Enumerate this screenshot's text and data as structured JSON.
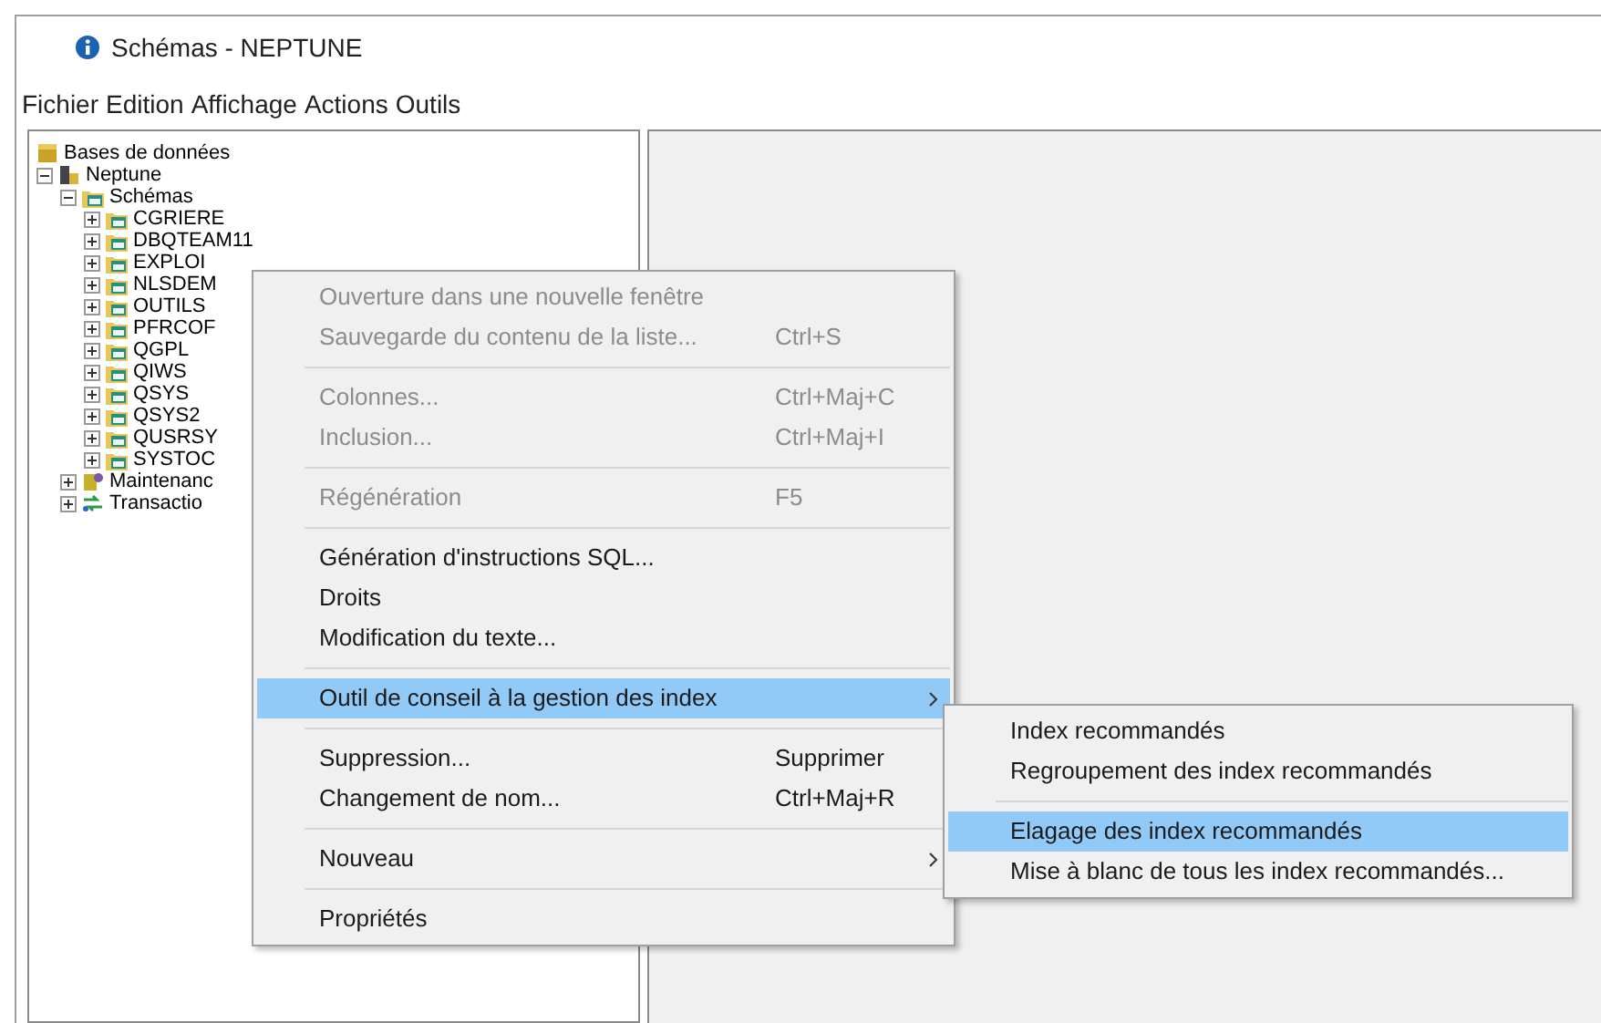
{
  "window": {
    "title": "Schémas - NEPTUNE"
  },
  "menubar": [
    "Fichier",
    "Edition",
    "Affichage",
    "Actions",
    "Outils"
  ],
  "tree": [
    {
      "label": "Bases de données",
      "kind": "databases",
      "children": [
        {
          "label": "Neptune",
          "kind": "system",
          "expanded": true,
          "children": [
            {
              "label": "Schémas",
              "kind": "schemas",
              "expanded": true,
              "children": [
                {
                  "label": "CGRIERE",
                  "kind": "schema",
                  "expanded": false
                },
                {
                  "label": "DBQTEAM11",
                  "kind": "schema",
                  "expanded": false
                },
                {
                  "label": "EXPLOI",
                  "kind": "schema",
                  "expanded": false
                },
                {
                  "label": "NLSDEM",
                  "kind": "schema",
                  "expanded": false
                },
                {
                  "label": "OUTILS",
                  "kind": "schema",
                  "expanded": false
                },
                {
                  "label": "PFRCOF",
                  "kind": "schema",
                  "expanded": false
                },
                {
                  "label": "QGPL",
                  "kind": "schema",
                  "expanded": false
                },
                {
                  "label": "QIWS",
                  "kind": "schema",
                  "expanded": false
                },
                {
                  "label": "QSYS",
                  "kind": "schema",
                  "expanded": false
                },
                {
                  "label": "QSYS2",
                  "kind": "schema",
                  "expanded": false
                },
                {
                  "label": "QUSRSY",
                  "kind": "schema",
                  "expanded": false
                },
                {
                  "label": "SYSTOC",
                  "kind": "schema",
                  "expanded": false
                }
              ]
            },
            {
              "label": "Maintenanc",
              "kind": "maintenance",
              "expanded": false
            },
            {
              "label": "Transactio",
              "kind": "transactions",
              "expanded": false
            }
          ]
        }
      ]
    }
  ],
  "context_menu": {
    "groups": [
      [
        {
          "label": "Ouverture dans une nouvelle fenêtre",
          "disabled": true,
          "selected": false,
          "submenu": false
        },
        {
          "label": "Sauvegarde du contenu de la liste...",
          "shortcut": "Ctrl+S",
          "disabled": true,
          "selected": false,
          "submenu": false
        }
      ],
      [
        {
          "label": "Colonnes...",
          "shortcut": "Ctrl+Maj+C",
          "disabled": true,
          "selected": false,
          "submenu": false
        },
        {
          "label": "Inclusion...",
          "shortcut": "Ctrl+Maj+I",
          "disabled": true,
          "selected": false,
          "submenu": false
        }
      ],
      [
        {
          "label": "Régénération",
          "shortcut": "F5",
          "disabled": true,
          "selected": false,
          "submenu": false
        }
      ],
      [
        {
          "label": "Génération d'instructions SQL...",
          "disabled": false,
          "selected": false,
          "submenu": false
        },
        {
          "label": "Droits",
          "disabled": false,
          "selected": false,
          "submenu": false
        },
        {
          "label": "Modification du texte...",
          "disabled": false,
          "selected": false,
          "submenu": false
        }
      ],
      [
        {
          "label": "Outil de conseil à la gestion des index",
          "disabled": false,
          "selected": true,
          "submenu": true
        }
      ],
      [
        {
          "label": "Suppression...",
          "shortcut": "Supprimer",
          "disabled": false,
          "selected": false,
          "submenu": false
        },
        {
          "label": "Changement de nom...",
          "shortcut": "Ctrl+Maj+R",
          "disabled": false,
          "selected": false,
          "submenu": false
        }
      ],
      [
        {
          "label": "Nouveau",
          "disabled": false,
          "selected": false,
          "submenu": true
        }
      ],
      [
        {
          "label": "Propriétés",
          "disabled": false,
          "selected": false,
          "submenu": false
        }
      ]
    ]
  },
  "submenu": {
    "groups": [
      [
        {
          "label": "Index recommandés",
          "disabled": false,
          "selected": false
        },
        {
          "label": "Regroupement des index recommandés",
          "disabled": false,
          "selected": false
        }
      ],
      [
        {
          "label": "Elagage des index recommandés",
          "disabled": false,
          "selected": true
        },
        {
          "label": "Mise à blanc de tous les index recommandés...",
          "disabled": false,
          "selected": false
        }
      ]
    ]
  }
}
